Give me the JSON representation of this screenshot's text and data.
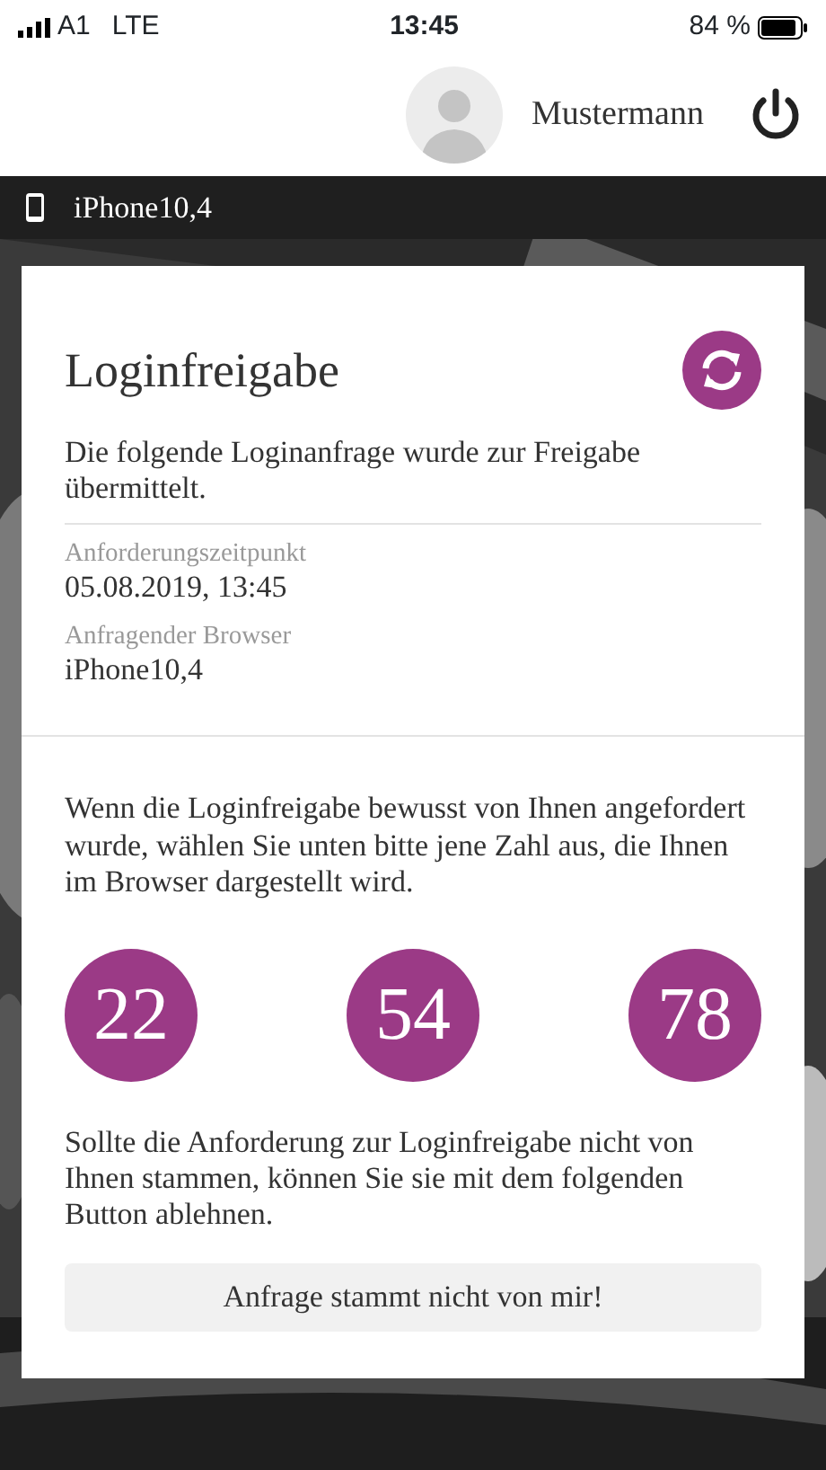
{
  "status_bar": {
    "carrier": "A1",
    "network": "LTE",
    "time": "13:45",
    "battery": "84 %"
  },
  "header": {
    "user_name": "Mustermann"
  },
  "device_bar": {
    "device": "iPhone10,4"
  },
  "card": {
    "title": "Loginfreigabe",
    "intro": "Die folgende Loginanfrage wurde zur Freigabe übermittelt.",
    "fields": [
      {
        "label": "Anforderungszeitpunkt",
        "value": "05.08.2019, 13:45"
      },
      {
        "label": "Anfragender Browser",
        "value": "iPhone10,4"
      }
    ],
    "instruction": "Wenn die Loginfreigabe bewusst von Ihnen angefordert wurde, wählen Sie unten bitte jene Zahl aus, die Ihnen im Browser dargestellt wird.",
    "numbers": [
      "22",
      "54",
      "78"
    ],
    "reject_text": "Sollte die Anforderung zur Loginfreigabe nicht von Ihnen stammen, können Sie sie mit dem folgenden Button ablehnen.",
    "reject_button": "Anfrage stammt nicht von mir!"
  }
}
